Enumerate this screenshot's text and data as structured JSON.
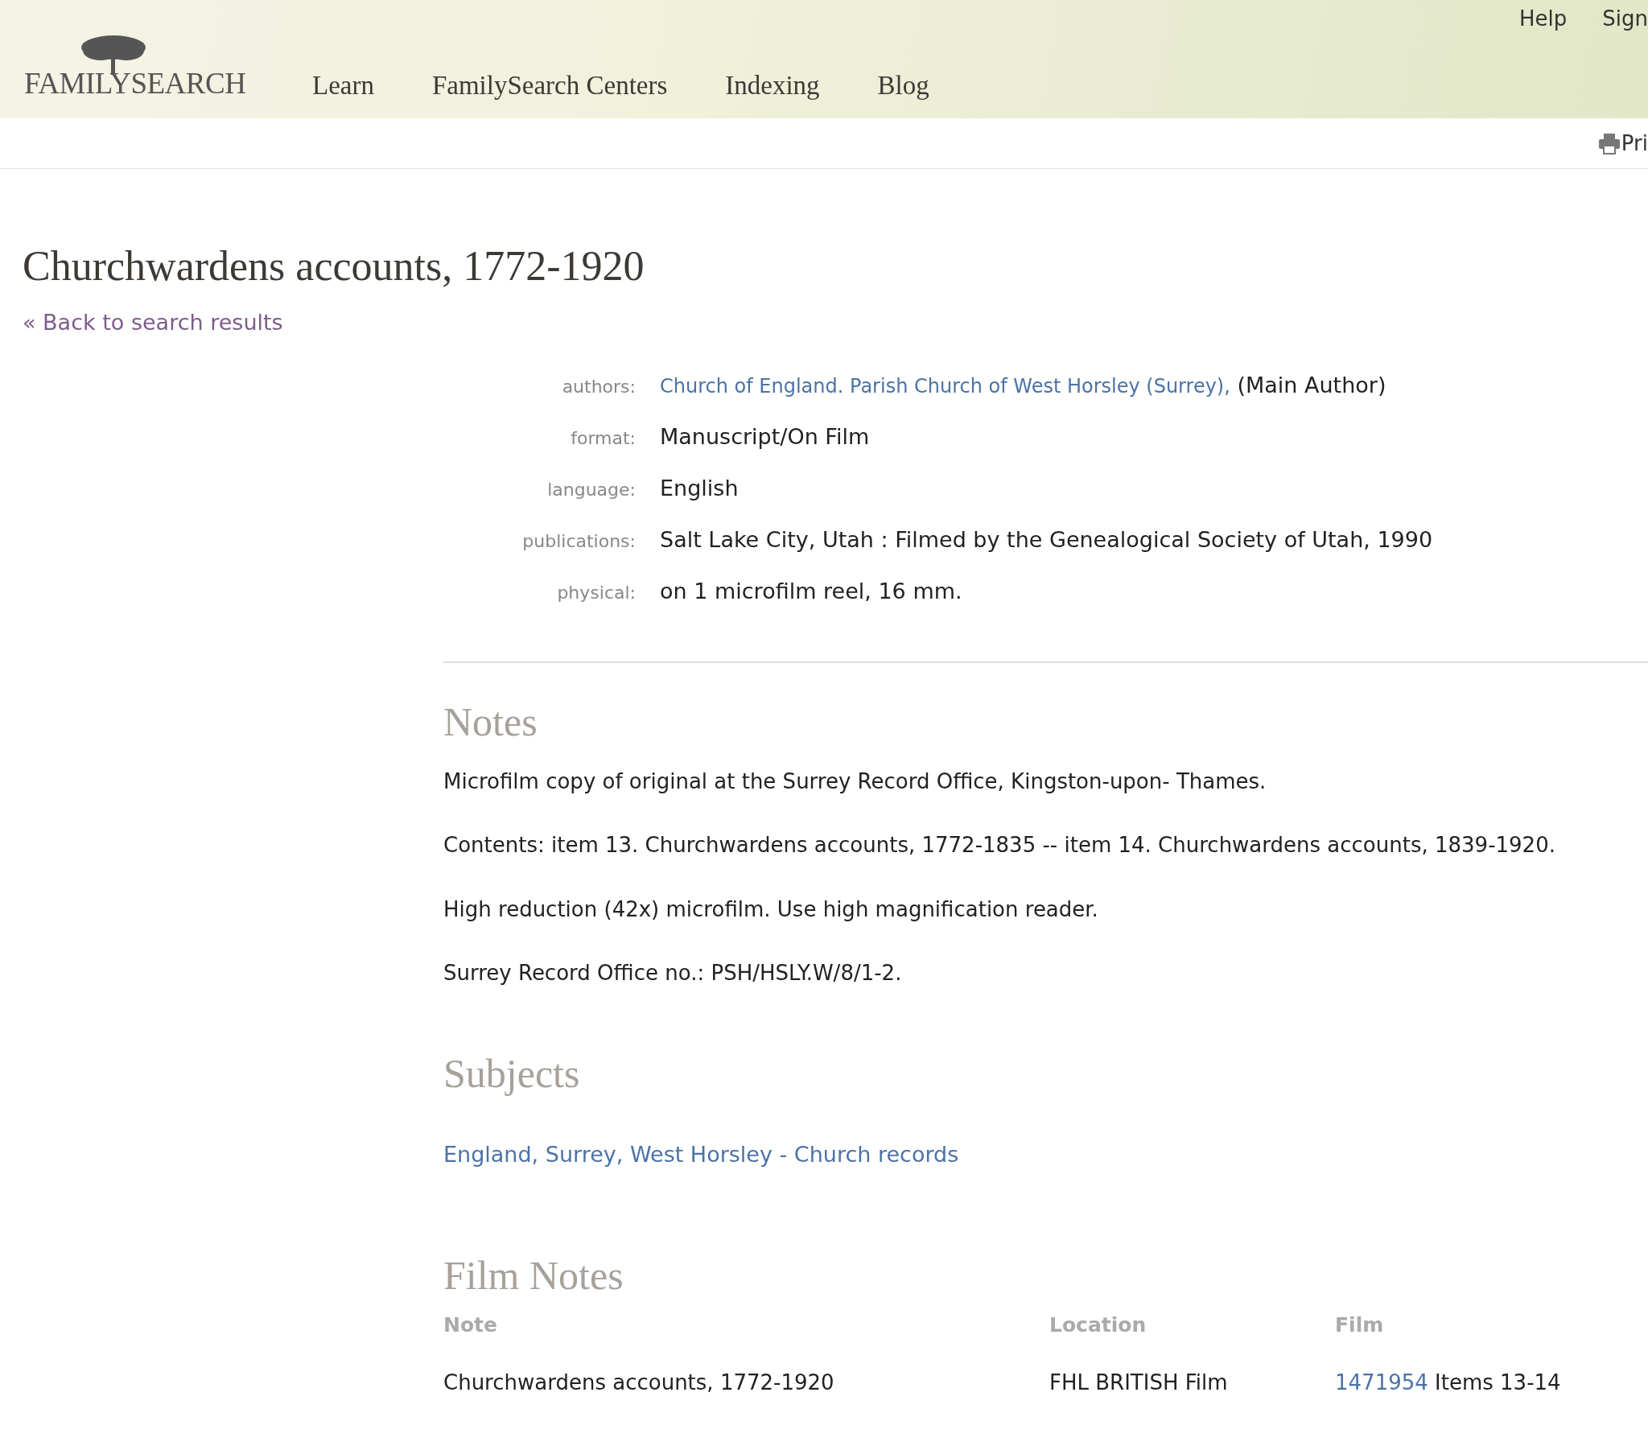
{
  "header": {
    "logo": "FAMILYSEARCH",
    "nav": [
      "Learn",
      "FamilySearch Centers",
      "Indexing",
      "Blog"
    ],
    "utility_links": [
      "Help",
      "Sign"
    ]
  },
  "toolbar": {
    "print": "Pri"
  },
  "title": "Churchwardens accounts, 1772-1920",
  "back_link": "« Back to search results",
  "details": [
    {
      "label": "authors:",
      "link": "Church of England. Parish Church of West Horsley (Surrey),",
      "value": "(Main Author)"
    },
    {
      "label": "format:",
      "value": "Manuscript/On Film"
    },
    {
      "label": "language:",
      "value": "English"
    },
    {
      "label": "publications:",
      "value": "Salt Lake City, Utah : Filmed by the Genealogical Society of Utah, 1990"
    },
    {
      "label": "physical:",
      "value": "on 1 microfilm reel, 16 mm."
    }
  ],
  "notes": {
    "heading": "Notes",
    "paragraphs": [
      "Microfilm copy of original at the Surrey Record Office, Kingston-upon- Thames.",
      "Contents: item 13. Churchwardens accounts, 1772-1835 -- item 14. Churchwardens accounts, 1839-1920.",
      "High reduction (42x) microfilm. Use high magnification reader.",
      "Surrey Record Office no.: PSH/HSLY.W/8/1-2."
    ]
  },
  "subjects": {
    "heading": "Subjects",
    "links": [
      "England, Surrey, West Horsley - Church records"
    ]
  },
  "film_notes": {
    "heading": "Film Notes",
    "columns": [
      "Note",
      "Location",
      "Film"
    ],
    "rows": [
      {
        "note": "Churchwardens accounts, 1772-1920",
        "location": "FHL BRITISH Film",
        "film_link": "1471954",
        "film_text": "Items 13-14"
      }
    ]
  }
}
